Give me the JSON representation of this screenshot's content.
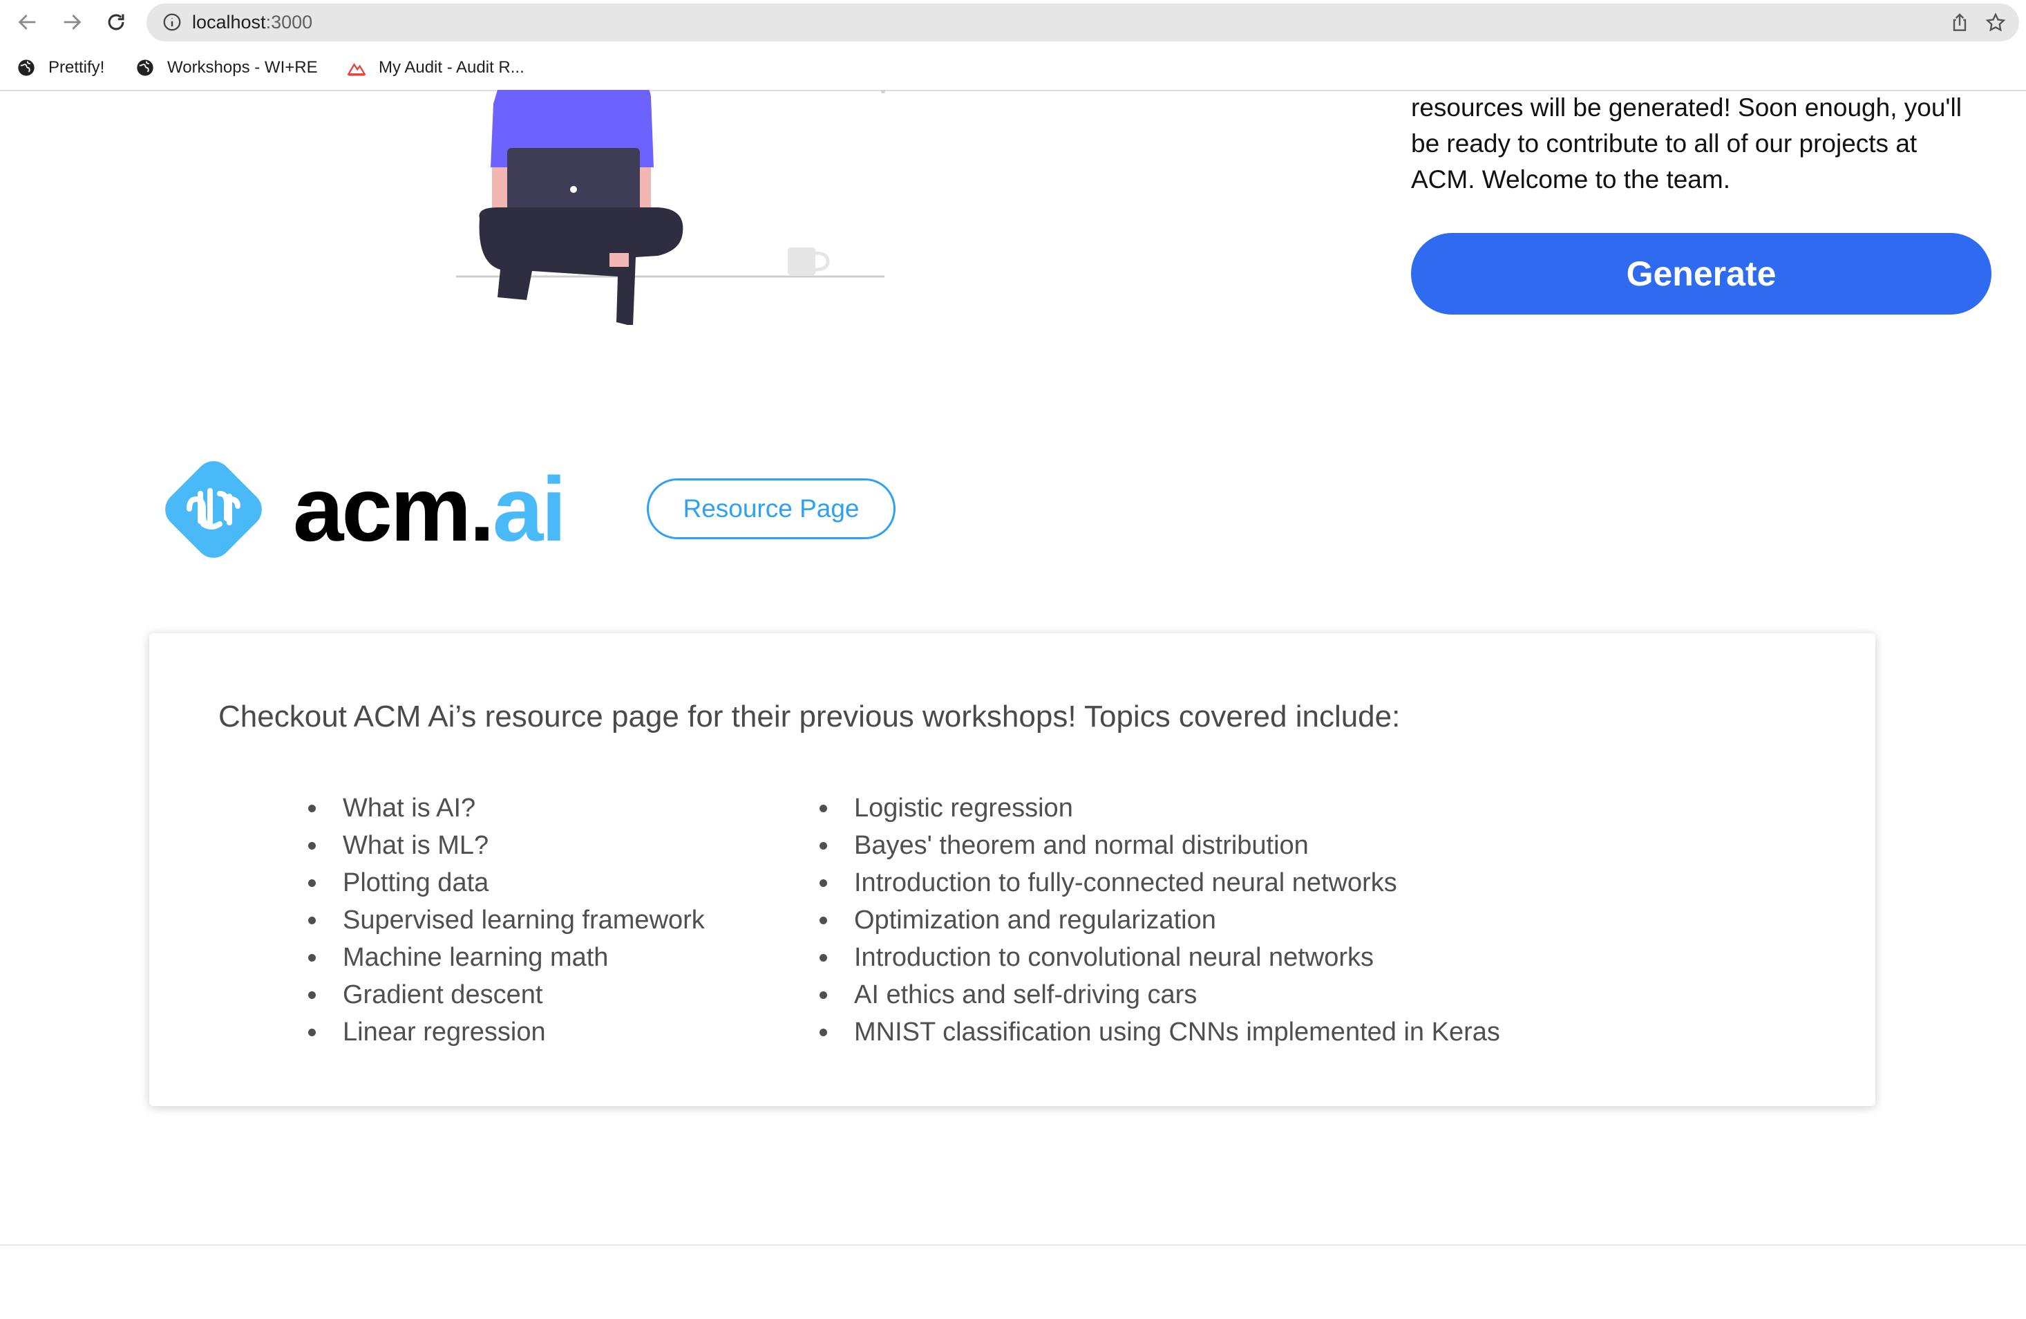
{
  "browser": {
    "url_host": "localhost",
    "url_port": ":3000",
    "bookmarks": [
      {
        "label": "Prettify!",
        "icon": "globe-icon"
      },
      {
        "label": "Workshops - WI+RE",
        "icon": "globe-icon"
      },
      {
        "label": "My Audit - Audit R...",
        "icon": "audit-chart-icon"
      }
    ]
  },
  "hero": {
    "intro_text": "resources will be generated! Soon enough, you'll be ready to contribute to all of our projects at ACM. Welcome to the team.",
    "generate_label": "Generate"
  },
  "acm_ai": {
    "logo_word": "acm.",
    "logo_accent": "ai",
    "resource_button_label": "Resource Page",
    "card_heading": "Checkout ACM Ai’s resource page for their previous workshops! Topics covered include:",
    "topics_left": [
      "What is AI?",
      "What is ML?",
      "Plotting data",
      "Supervised learning framework",
      "Machine learning math",
      "Gradient descent",
      "Linear regression"
    ],
    "topics_right": [
      "Logistic regression",
      "Bayes' theorem and normal distribution",
      "Introduction to fully-connected neural networks",
      "Optimization and regularization",
      "Introduction to convolutional neural networks",
      "AI ethics and self-driving cars",
      "MNIST classification using CNNs implemented in Keras"
    ]
  },
  "colors": {
    "generate_button": "#2f6bf0",
    "resource_button": "#2ea2f0",
    "logo_accent": "#49b9f7",
    "illustration_shirt": "#6c63ff"
  }
}
